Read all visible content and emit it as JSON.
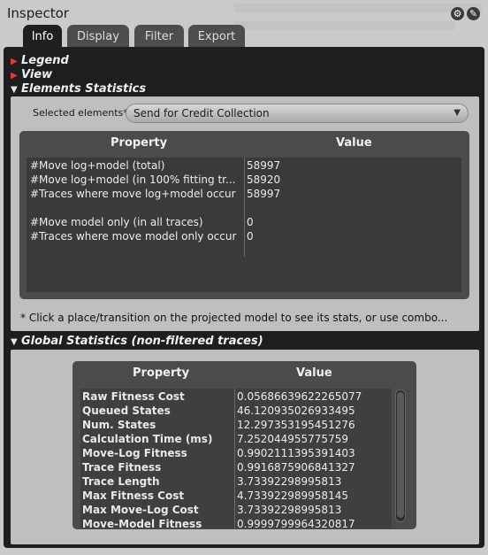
{
  "window": {
    "title": "Inspector"
  },
  "tabs": [
    {
      "label": "Info",
      "active": true
    },
    {
      "label": "Display",
      "active": false
    },
    {
      "label": "Filter",
      "active": false
    },
    {
      "label": "Export",
      "active": false
    }
  ],
  "sections": {
    "legend": "Legend",
    "view": "View",
    "elements_statistics": "Elements Statistics",
    "global_statistics": "Global Statistics (non-filtered traces)"
  },
  "elements": {
    "selected_label": "Selected elements*",
    "selected_value": "Send for Credit Collection",
    "columns": [
      "Property",
      "Value"
    ],
    "rows": [
      {
        "property": "#Move log+model (total)",
        "value": "58997"
      },
      {
        "property": "#Move log+model (in 100% fitting tr...",
        "value": "58920"
      },
      {
        "property": "#Traces where move log+model occur",
        "value": "58997"
      },
      {
        "property": "#Move model only (in all traces)",
        "value": "0"
      },
      {
        "property": "#Traces where move model only occur",
        "value": "0"
      }
    ],
    "hint": "* Click a place/transition on the projected model to see its stats, or use combo..."
  },
  "global": {
    "columns": [
      "Property",
      "Value"
    ],
    "rows": [
      {
        "property": "Raw Fitness Cost",
        "value": "0.05686639622265077"
      },
      {
        "property": "Queued States",
        "value": "46.120935026933495"
      },
      {
        "property": "Num. States",
        "value": "12.297353195451276"
      },
      {
        "property": "Calculation Time (ms)",
        "value": "7.252044955775759"
      },
      {
        "property": "Move-Log Fitness",
        "value": "0.9902111395391403"
      },
      {
        "property": "Trace Fitness",
        "value": "0.9916875906841327"
      },
      {
        "property": "Trace Length",
        "value": "3.73392298995813"
      },
      {
        "property": "Max Fitness Cost",
        "value": "4.733922989958145"
      },
      {
        "property": "Max Move-Log Cost",
        "value": "3.73392298995813"
      },
      {
        "property": "Move-Model Fitness",
        "value": "0.9999799964320817"
      }
    ]
  },
  "colors": {
    "accent_red": "#e23b3b",
    "panel_dark": "#1e1e1e"
  }
}
